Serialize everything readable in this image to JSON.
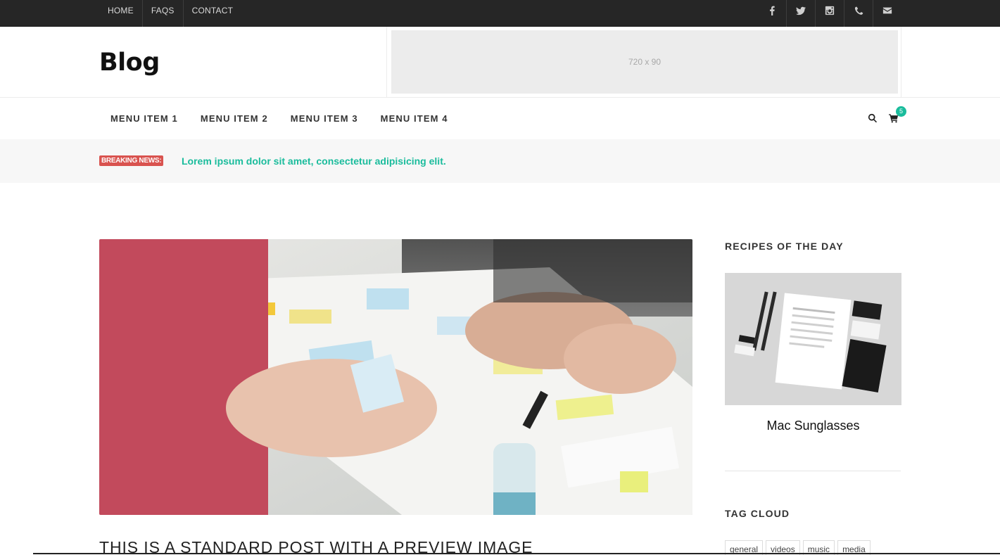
{
  "topbar": {
    "links": [
      "HOME",
      "FAQS",
      "CONTACT"
    ],
    "social_icons": [
      "facebook-icon",
      "twitter-icon",
      "instagram-icon",
      "phone-icon",
      "mail-icon"
    ]
  },
  "header": {
    "logo": "Blog",
    "ad_label": "720 x 90"
  },
  "menu": {
    "items": [
      "MENU ITEM 1",
      "MENU ITEM 2",
      "MENU ITEM 3",
      "MENU ITEM 4"
    ],
    "cart_count": "5"
  },
  "breaking": {
    "label": "BREAKING NEWS:",
    "text": "Lorem ipsum dolor sit amet, consectetur adipisicing elit."
  },
  "post": {
    "title": "THIS IS A STANDARD POST WITH A PREVIEW IMAGE"
  },
  "sidebar": {
    "recipes_title": "RECIPES OF THE DAY",
    "recipe_name": "Mac Sunglasses",
    "tagcloud_title": "TAG CLOUD",
    "tags": [
      "general",
      "videos",
      "music",
      "media"
    ]
  },
  "colors": {
    "accent": "#1abc9c",
    "breaking": "#d9534f",
    "topbar": "#262626"
  }
}
